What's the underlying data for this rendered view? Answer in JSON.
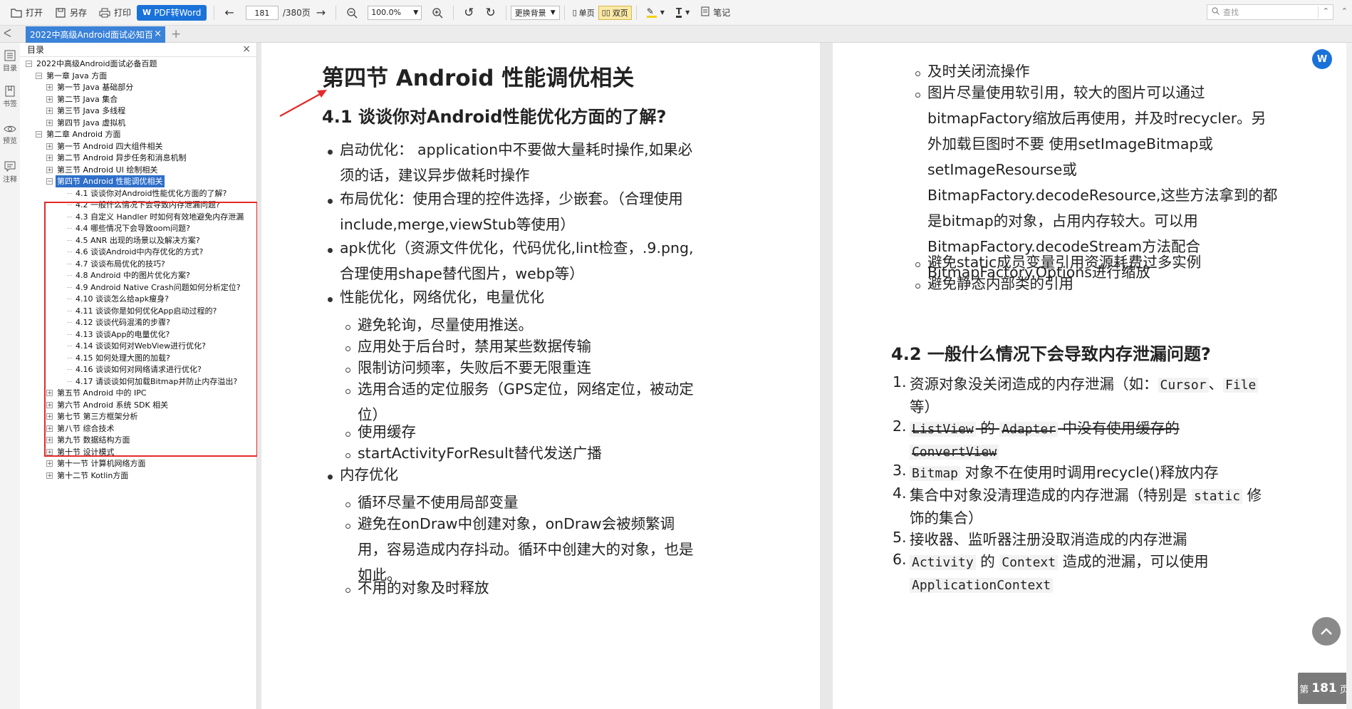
{
  "toolbar": {
    "open": "打开",
    "save_as": "另存",
    "print": "打印",
    "pdf_to_word": "PDF转Word",
    "page_current": "181",
    "page_total": "/380页",
    "zoom": "100.0%",
    "background": "更换背景",
    "single_page": "单页",
    "double_page": "双页",
    "note": "笔记",
    "search_placeholder": "查找"
  },
  "tabs": [
    {
      "label": "2022中高级Android面试必知百"
    }
  ],
  "rail": [
    {
      "label": "目录",
      "icon": "list-icon"
    },
    {
      "label": "书签",
      "icon": "bookmark-icon"
    },
    {
      "label": "预览",
      "icon": "eye-icon"
    },
    {
      "label": "注释",
      "icon": "comment-icon"
    }
  ],
  "outline": {
    "title": "目录",
    "root": "2022中高级Android面试必备百题",
    "chapter1": "第一章 Java 方面",
    "ch1_items": [
      "第一节 Java 基础部分",
      "第二节 Java 集合",
      "第三节 Java 多线程",
      "第四节 Java 虚拟机"
    ],
    "chapter2": "第二章 Android 方面",
    "ch2_items_before": [
      "第一节 Android 四大组件相关",
      "第二节 Android 异步任务和消息机制",
      "第三节 Android UI 绘制相关"
    ],
    "selected_section": "第四节 Android 性能调优相关",
    "section4_items": [
      "4.1 谈谈你对Android性能优化方面的了解?",
      "4.2 一般什么情况下会导致内存泄漏问题?",
      "4.3 自定义 Handler 时如何有效地避免内存泄漏",
      "4.4 哪些情况下会导致oom问题?",
      "4.5 ANR 出现的场景以及解决方案?",
      "4.6 谈谈Android中内存优化的方式?",
      "4.7 谈谈布局优化的技巧?",
      "4.8 Android 中的图片优化方案?",
      "4.9 Android Native Crash问题如何分析定位?",
      "4.10 谈谈怎么给apk瘦身?",
      "4.11 谈谈你是如何优化App启动过程的?",
      "4.12 谈谈代码混淆的步骤?",
      "4.13 谈谈App的电量优化?",
      "4.14 谈谈如何对WebView进行优化?",
      "4.15 如何处理大图的加载?",
      "4.16 谈谈如何对网络请求进行优化?",
      "4.17 请谈谈如何加载Bitmap并防止内存溢出?"
    ],
    "ch2_items_after": [
      "第五节 Android 中的 IPC",
      "第六节 Android 系统 SDK 相关",
      "第七节 第三方框架分析",
      "第八节 综合技术",
      "第九节 数据结构方面",
      "第十节 设计模式",
      "第十一节 计算机网络方面",
      "第十二节 Kotlin方面"
    ]
  },
  "left_page": {
    "section_title": "第四节 Android 性能调优相关",
    "q41_title": "4.1 谈谈你对Android性能优化方面的了解?",
    "b1": [
      "启动优化： application中不要做大量耗时操作,如果必",
      "须的话，建议异步做耗时操作"
    ],
    "b2": [
      "布局优化：使用合理的控件选择，少嵌套。（合理使用",
      "include,merge,viewStub等使用）"
    ],
    "b3": [
      "apk优化（资源文件优化，代码优化,lint检查，.9.png,",
      "合理使用shape替代图片，webp等）"
    ],
    "b4": "性能优化，网络优化，电量优化",
    "b4_sub": [
      "避免轮询，尽量使用推送。",
      "应用处于后台时，禁用某些数据传输",
      "限制访问频率，失败后不要无限重连",
      "选用合适的定位服务（GPS定位，网络定位，被动定",
      "位）",
      "使用缓存",
      "startActivityForResult替代发送广播"
    ],
    "b5": "内存优化",
    "b5_sub": [
      "循环尽量不使用局部变量",
      "避免在onDraw中创建对象，onDraw会被频繁调",
      "用，容易造成内存抖动。循环中创建大的对象，也是",
      "如此。",
      "不用的对象及时释放"
    ]
  },
  "right_page": {
    "top_sub": [
      "及时关闭流操作",
      "图片尽量使用软引用，较大的图片可以通过",
      "bitmapFactory缩放后再使用，并及时recycler。另",
      "外加载巨图时不要 使用setImageBitmap或",
      "setImageResourse或",
      "BitmapFactory.decodeResource,这些方法拿到的都",
      "是bitmap的对象，占用内存较大。可以用",
      "BitmapFactory.decodeStream方法配合",
      "BitmapFactory.Options进行缩放",
      "避免static成员变量引用资源耗费过多实例",
      "避免静态内部类的引用"
    ],
    "q42_title": "4.2 一般什么情况下会导致内存泄漏问题?",
    "items": {
      "i1_num": "1.",
      "i1_a": "资源对象没关闭造成的内存泄漏（如：",
      "i1_code1": "Cursor",
      "i1_mid": "、",
      "i1_code2": "File",
      "i1_b": "等）",
      "i2_num": "2.",
      "i2_code1": "ListView",
      "i2_mid": " 的 ",
      "i2_code2": "Adapter",
      "i2_tail": " 中没有使用缓存的",
      "i2_code3": "ConvertView",
      "i3_num": "3.",
      "i3_code": "Bitmap",
      "i3_text": " 对象不在使用时调用recycle()释放内存",
      "i4_num": "4.",
      "i4_a": "集合中对象没清理造成的内存泄漏（特别是",
      "i4_code": "static",
      "i4_b": "修",
      "i4_c": "饰的集合）",
      "i5_num": "5.",
      "i5_text": "接收器、监听器注册没取消造成的内存泄漏",
      "i6_num": "6.",
      "i6_code1": "Activity",
      "i6_mid": " 的 ",
      "i6_code2": "Context",
      "i6_text": " 造成的泄漏，可以使用",
      "i6_code3": "ApplicationContext"
    }
  },
  "page_badge": {
    "prefix": "第",
    "number": "181",
    "suffix": "页"
  },
  "colors": {
    "accent": "#1a72d9",
    "selection": "#2f6fc9",
    "highlight_border": "#e32a2a",
    "arrow": "#e32a2a"
  }
}
